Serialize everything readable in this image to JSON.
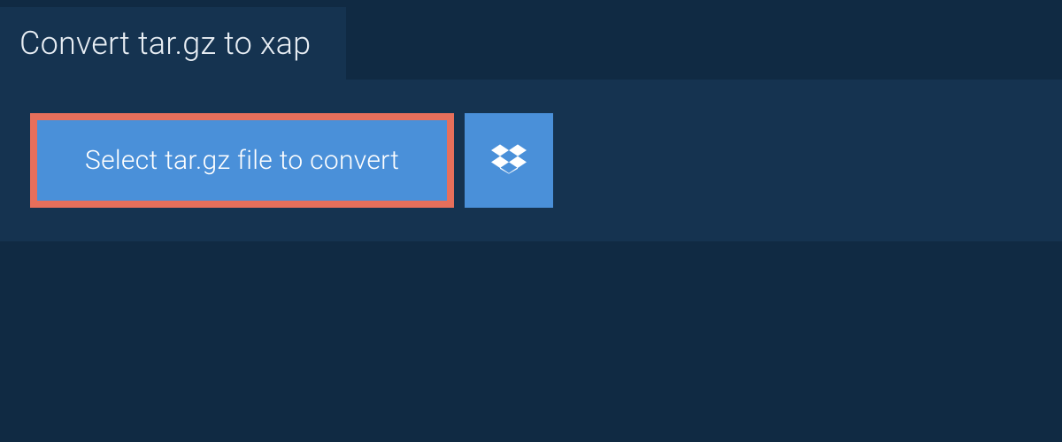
{
  "header": {
    "title": "Convert tar.gz to xap"
  },
  "actions": {
    "select_file_label": "Select tar.gz file to convert",
    "dropbox_icon": "dropbox-icon"
  },
  "colors": {
    "background": "#102a43",
    "panel": "#153350",
    "button": "#4a90d9",
    "highlight_border": "#e76f5b",
    "text_light": "#ffffff"
  }
}
